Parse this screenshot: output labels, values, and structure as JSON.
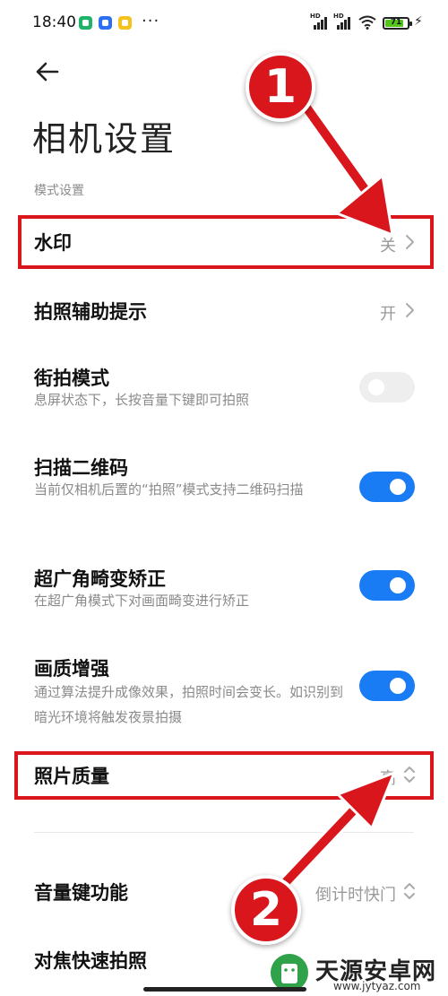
{
  "status_bar": {
    "time": "18:40",
    "app_icons": [
      "green-shield-icon",
      "blue-app-icon",
      "yellow-app-icon"
    ],
    "overflow": "···",
    "signal_1_label": "HD",
    "signal_2_label": "HD",
    "battery": "71",
    "charging": "⚡"
  },
  "header": {
    "back_icon": "back-arrow-icon",
    "title": "相机设置"
  },
  "section_label": "模式设置",
  "settings": {
    "watermark": {
      "title": "水印",
      "value": "关"
    },
    "shooting_hint": {
      "title": "拍照辅助提示",
      "value": "开"
    },
    "street_mode": {
      "title": "街拍模式",
      "subtitle": "息屏状态下，长按音量下键即可拍照",
      "enabled": false
    },
    "scan_qr": {
      "title": "扫描二维码",
      "subtitle": "当前仅相机后置的“拍照”模式支持二维码扫描",
      "enabled": true
    },
    "ultrawide_correction": {
      "title": "超广角畸变矫正",
      "subtitle": "在超广角模式下对画面畸变进行矫正",
      "enabled": true
    },
    "quality_enhance": {
      "title": "画质增强",
      "subtitle": "通过算法提升成像效果，拍照时间会变长。如识别到暗光环境将触发夜景拍摄",
      "enabled": true
    },
    "photo_quality": {
      "title": "照片质量",
      "value": "高"
    },
    "volume_key": {
      "title": "音量键功能",
      "value": "倒计时快门"
    },
    "focus_shoot": {
      "title": "对焦快速拍照"
    }
  },
  "annotations": {
    "badge_1": "1",
    "badge_2": "2",
    "highlight_color": "#d9161c"
  },
  "watermark_site": {
    "name": "天源安卓网",
    "url": "www.jytyaz.com"
  },
  "colors": {
    "toggle_on": "#1a7cf5",
    "toggle_off": "#eeeeee",
    "accent_red": "#d9161c"
  }
}
